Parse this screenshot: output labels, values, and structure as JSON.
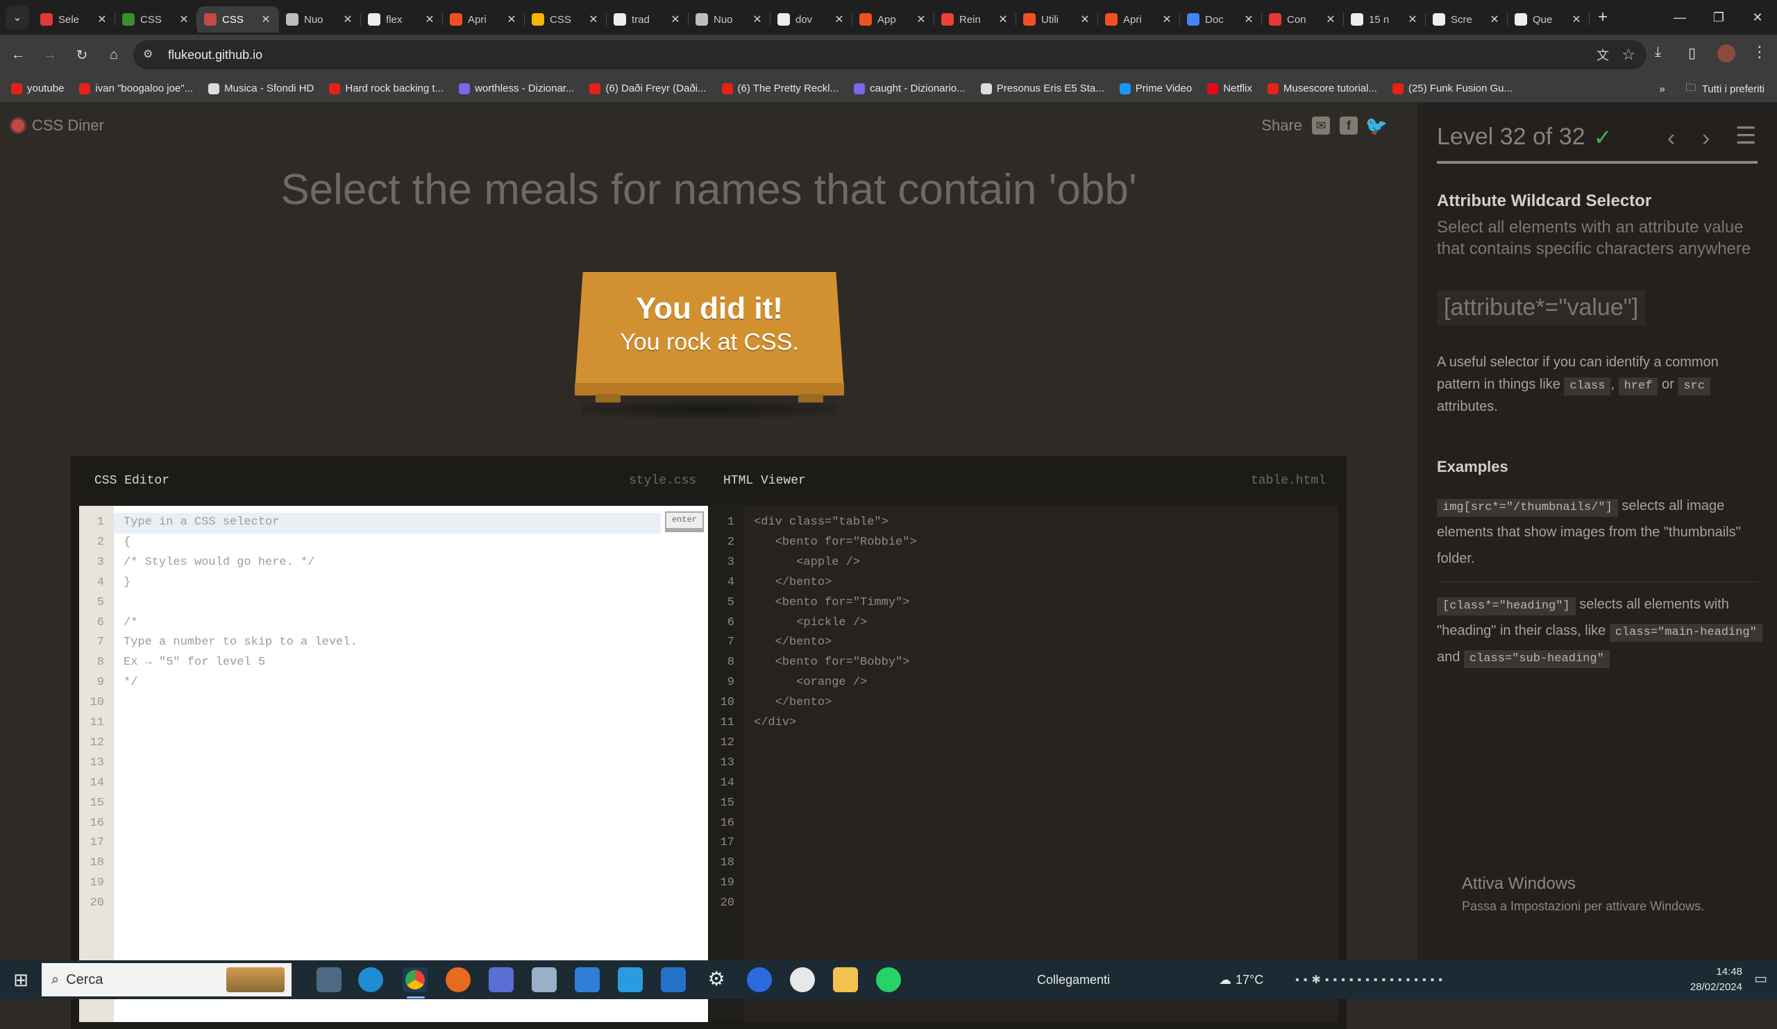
{
  "browser": {
    "tabs": [
      {
        "label": "Sele",
        "color": "#e53935"
      },
      {
        "label": "CSS",
        "color": "#3c8d2f"
      },
      {
        "label": "CSS",
        "color": "#c24a45",
        "active": true
      },
      {
        "label": "Nuo",
        "color": "#bdbdbd"
      },
      {
        "label": "flex",
        "color": "#eeeeee"
      },
      {
        "label": "Apri",
        "color": "#f25022"
      },
      {
        "label": "CSS",
        "color": "#f4b400"
      },
      {
        "label": "trad",
        "color": "#eeeeee"
      },
      {
        "label": "Nuo",
        "color": "#bdbdbd"
      },
      {
        "label": "dov",
        "color": "#eeeeee"
      },
      {
        "label": "App",
        "color": "#f25022"
      },
      {
        "label": "Rein",
        "color": "#ea4335"
      },
      {
        "label": "Utili",
        "color": "#f25022"
      },
      {
        "label": "Apri",
        "color": "#f25022"
      },
      {
        "label": "Doc",
        "color": "#4285f4"
      },
      {
        "label": "Con",
        "color": "#e53935"
      },
      {
        "label": "15 n",
        "color": "#eeeeee"
      },
      {
        "label": "Scre",
        "color": "#eeeeee"
      },
      {
        "label": "Que",
        "color": "#eeeeee"
      }
    ],
    "url": "flukeout.github.io",
    "bookmarks": [
      {
        "label": "youtube",
        "color": "#e62117"
      },
      {
        "label": "ivan \"boogaloo joe\"...",
        "color": "#e62117"
      },
      {
        "label": "Musica - Sfondi HD",
        "color": "#dddddd"
      },
      {
        "label": "Hard rock backing t...",
        "color": "#e62117"
      },
      {
        "label": "worthless - Dizionar...",
        "color": "#7b68ee"
      },
      {
        "label": "(6) Daði Freyr (Daði...",
        "color": "#e62117"
      },
      {
        "label": "(6) The Pretty Reckl...",
        "color": "#e62117"
      },
      {
        "label": "caught - Dizionario...",
        "color": "#7b68ee"
      },
      {
        "label": "Presonus Eris E5 Sta...",
        "color": "#dddddd"
      },
      {
        "label": "Prime Video",
        "color": "#1a98ff"
      },
      {
        "label": "Netflix",
        "color": "#e50914"
      },
      {
        "label": "Musescore tutorial...",
        "color": "#e62117"
      },
      {
        "label": "(25) Funk Fusion Gu...",
        "color": "#e62117"
      }
    ],
    "all_bookmarks": "Tutti i preferiti"
  },
  "game": {
    "logo": "CSS Diner",
    "share_label": "Share",
    "order": "Select the meals for names that contain 'obb'",
    "win_line1": "You did it!",
    "win_line2": "You rock at CSS.",
    "css_editor_title": "CSS Editor",
    "css_file": "style.css",
    "html_viewer_title": "HTML Viewer",
    "html_file": "table.html",
    "enter_label": "enter",
    "css_lines": [
      "Type in a CSS selector",
      "{",
      "/* Styles would go here. */",
      "}",
      "",
      "/*",
      "Type a number to skip to a level.",
      "Ex → \"5\" for level 5",
      "*/"
    ],
    "html_lines": [
      "<div class=\"table\">",
      "   <bento for=\"Robbie\">",
      "      <apple />",
      "   </bento>",
      "   <bento for=\"Timmy\">",
      "      <pickle />",
      "   </bento>",
      "   <bento for=\"Bobby\">",
      "      <orange />",
      "   </bento>",
      "</div>"
    ],
    "line_count": 20
  },
  "sidebar": {
    "level": "Level 32 of 32",
    "level_progress": 1.0,
    "selector_name": "Attribute Wildcard Selector",
    "selector_desc": "Select all elements with an attribute value that contains specific characters anywhere",
    "syntax": "[attribute*=\"value\"]",
    "help_pre": "A useful selector if you can identify a common pattern in things like",
    "help_code1": "class",
    "help_sep1": ",",
    "help_code2": "href",
    "help_or": "or",
    "help_code3": "src",
    "help_post": "attributes.",
    "examples_title": "Examples",
    "ex1_code": "img[src*=\"/thumbnails/\"]",
    "ex1_text": "selects all image elements that show images from the \"thumbnails\" folder.",
    "ex2_code": "[class*=\"heading\"]",
    "ex2_text1": "selects all elements with \"heading\" in their class, like",
    "ex2_code2": "class=\"main-heading\"",
    "ex2_and": "and",
    "ex2_code3": "class=\"sub-heading\""
  },
  "watermark": {
    "title": "Attiva Windows",
    "subtitle": "Passa a Impostazioni per attivare Windows."
  },
  "taskbar": {
    "search": "Cerca",
    "links": "Collegamenti",
    "temperature": "17°C",
    "time": "14:48",
    "date": "28/02/2024"
  }
}
